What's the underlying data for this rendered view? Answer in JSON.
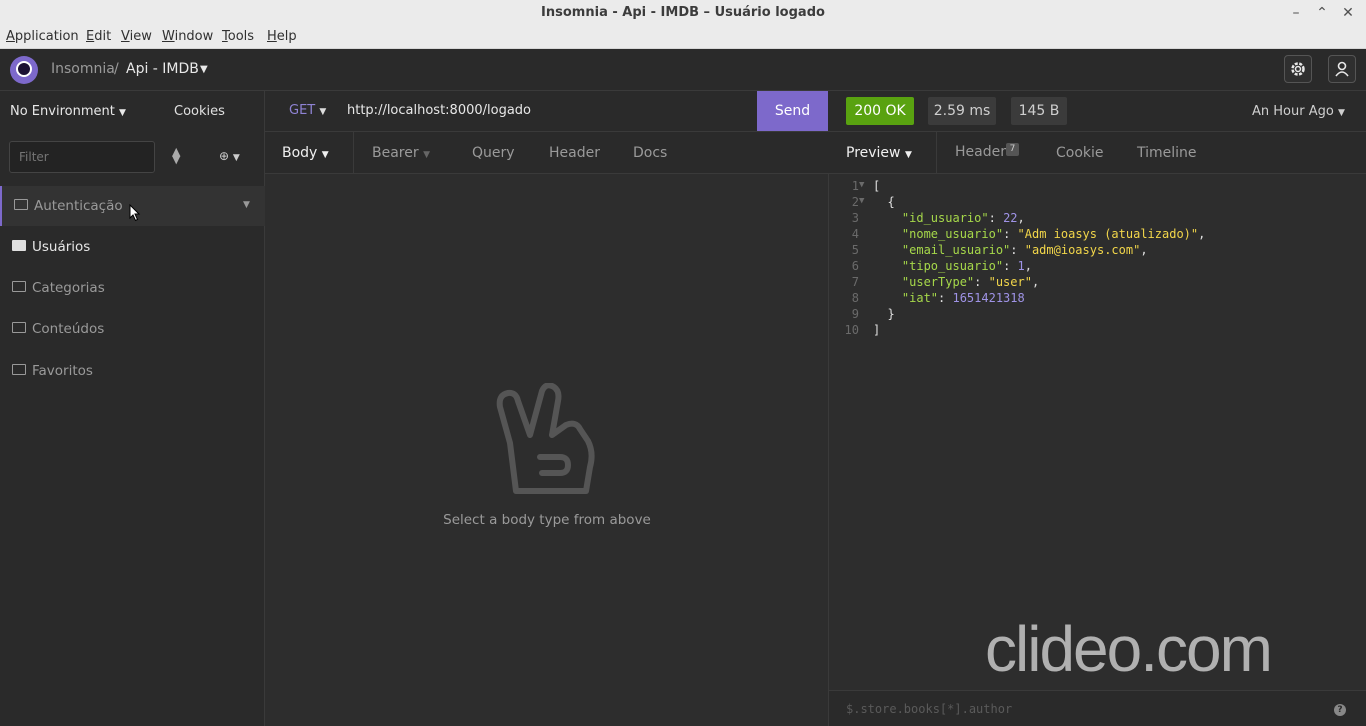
{
  "window": {
    "title": "Insomnia - Api - IMDB – Usuário logado"
  },
  "menu": [
    "Application",
    "Edit",
    "View",
    "Window",
    "Tools",
    "Help"
  ],
  "app": {
    "brand": "Insomnia",
    "separator": "/",
    "workspace": "Api - IMDB"
  },
  "sidebar": {
    "environment": "No Environment",
    "cookies": "Cookies",
    "filter_placeholder": "Filter",
    "folders": [
      {
        "label": "Autenticação"
      },
      {
        "label": "Usuários"
      },
      {
        "label": "Categorias"
      },
      {
        "label": "Conteúdos"
      },
      {
        "label": "Favoritos"
      }
    ]
  },
  "request": {
    "method": "GET",
    "url": "http://localhost:8000/logado",
    "send_label": "Send",
    "tabs": {
      "body": "Body",
      "auth": "Bearer",
      "query": "Query",
      "header": "Header",
      "docs": "Docs"
    },
    "empty_hint": "Select a body type from above"
  },
  "response": {
    "status": "200 OK",
    "time": "2.59 ms",
    "size": "145 B",
    "when": "An Hour Ago",
    "tabs": {
      "preview": "Preview",
      "header": "Header",
      "header_count": "7",
      "cookie": "Cookie",
      "timeline": "Timeline"
    },
    "json": {
      "id_usuario_key": "\"id_usuario\"",
      "id_usuario_value": "22",
      "nome_usuario_key": "\"nome_usuario\"",
      "nome_usuario_value": "\"Adm ioasys (atualizado)\"",
      "email_usuario_key": "\"email_usuario\"",
      "email_usuario_value": "\"adm@ioasys.com\"",
      "tipo_usuario_key": "\"tipo_usuario\"",
      "tipo_usuario_value": "1",
      "userType_key": "\"userType\"",
      "userType_value": "\"user\"",
      "iat_key": "\"iat\"",
      "iat_value": "1651421318"
    },
    "query_placeholder": "$.store.books[*].author"
  },
  "watermark": "clideo.com",
  "colors": {
    "accent": "#7d69cb",
    "status_ok": "#59a210"
  }
}
